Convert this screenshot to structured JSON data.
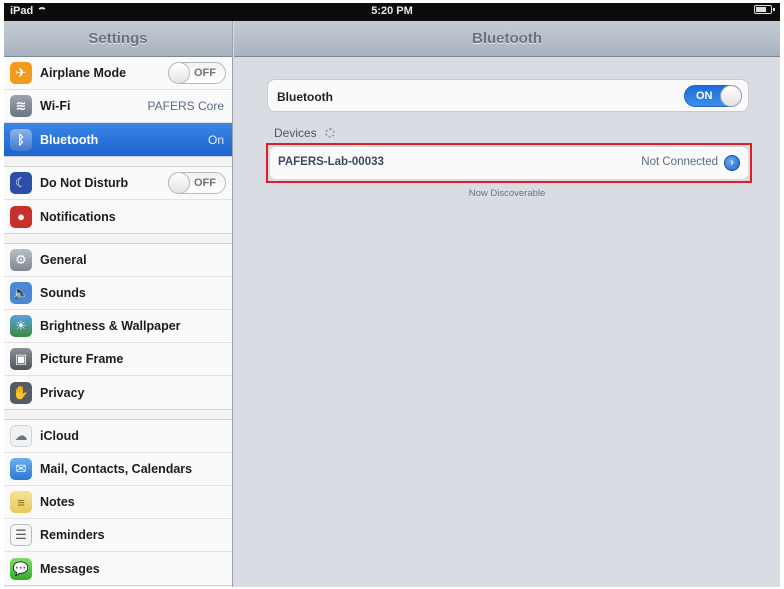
{
  "status_bar": {
    "device": "iPad",
    "time": "5:20 PM"
  },
  "sidebar": {
    "title": "Settings",
    "groups": [
      [
        {
          "label": "Airplane Mode",
          "icon": "airplane-icon",
          "toggle": "OFF"
        },
        {
          "label": "Wi-Fi",
          "icon": "wifi-icon",
          "value": "PAFERS Core"
        },
        {
          "label": "Bluetooth",
          "icon": "bluetooth-icon",
          "value": "On",
          "selected": true
        }
      ],
      [
        {
          "label": "Do Not Disturb",
          "icon": "moon-icon",
          "toggle": "OFF"
        },
        {
          "label": "Notifications",
          "icon": "notifications-icon"
        }
      ],
      [
        {
          "label": "General",
          "icon": "gear-icon"
        },
        {
          "label": "Sounds",
          "icon": "speaker-icon"
        },
        {
          "label": "Brightness & Wallpaper",
          "icon": "brightness-icon"
        },
        {
          "label": "Picture Frame",
          "icon": "picture-frame-icon"
        },
        {
          "label": "Privacy",
          "icon": "hand-icon"
        }
      ],
      [
        {
          "label": "iCloud",
          "icon": "cloud-icon"
        },
        {
          "label": "Mail, Contacts, Calendars",
          "icon": "mail-icon"
        },
        {
          "label": "Notes",
          "icon": "notes-icon"
        },
        {
          "label": "Reminders",
          "icon": "reminders-icon"
        },
        {
          "label": "Messages",
          "icon": "messages-icon"
        }
      ]
    ]
  },
  "detail": {
    "title": "Bluetooth",
    "bluetooth_label": "Bluetooth",
    "bluetooth_toggle": "ON",
    "devices_header": "Devices",
    "device": {
      "name": "PAFERS-Lab-00033",
      "status": "Not Connected"
    },
    "discoverable_text": "Now Discoverable"
  },
  "colors": {
    "selected_row": "#2a74dc",
    "toggle_on": "#2a7de6",
    "highlight_outline": "#e01e26"
  }
}
